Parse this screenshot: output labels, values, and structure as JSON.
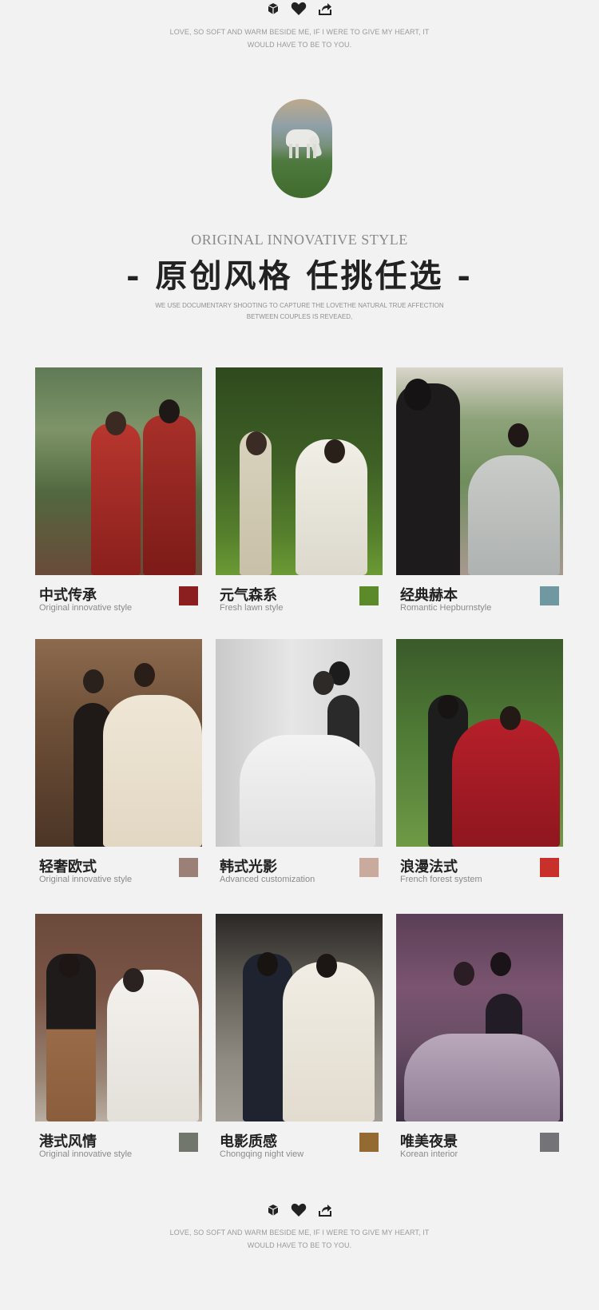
{
  "top_icons": [
    "cube-icon",
    "heart-icon",
    "share-icon"
  ],
  "tagline": {
    "line1": "LOVE, SO SOFT AND WARM BESIDE ME, IF I WERE TO GIVE MY HEART, IT",
    "line2": "WOULD HAVE TO BE TO YOU."
  },
  "heading": {
    "en": "ORIGINAL INNOVATIVE STYLE",
    "cn": "- 原创风格 任挑任选 -",
    "desc1": "WE USE DOCUMENTARY SHOOTING TO CAPTURE THE LOVETHE NATURAL TRUE AFFECTION",
    "desc2": "BETWEEN COUPLES IS REVEAED,"
  },
  "styles": [
    {
      "title": "中式传承",
      "subtitle": "Original innovative style",
      "color": "#8b1e1e"
    },
    {
      "title": "元气森系",
      "subtitle": "Fresh lawn style",
      "color": "#5c8a2a"
    },
    {
      "title": "经典赫本",
      "subtitle": "Romantic Hepburnstyle",
      "color": "#6f98a0"
    },
    {
      "title": "轻奢欧式",
      "subtitle": "Original innovative style",
      "color": "#9b8078"
    },
    {
      "title": "韩式光影",
      "subtitle": "Advanced customization",
      "color": "#c9aa9c"
    },
    {
      "title": "浪漫法式",
      "subtitle": "French forest system",
      "color": "#c8302c"
    },
    {
      "title": "港式风情",
      "subtitle": "Original innovative style",
      "color": "#72776e"
    },
    {
      "title": "电影质感",
      "subtitle": "Chongqing night view",
      "color": "#936a32"
    },
    {
      "title": "唯美夜景",
      "subtitle": "Korean interior",
      "color": "#747377"
    }
  ]
}
